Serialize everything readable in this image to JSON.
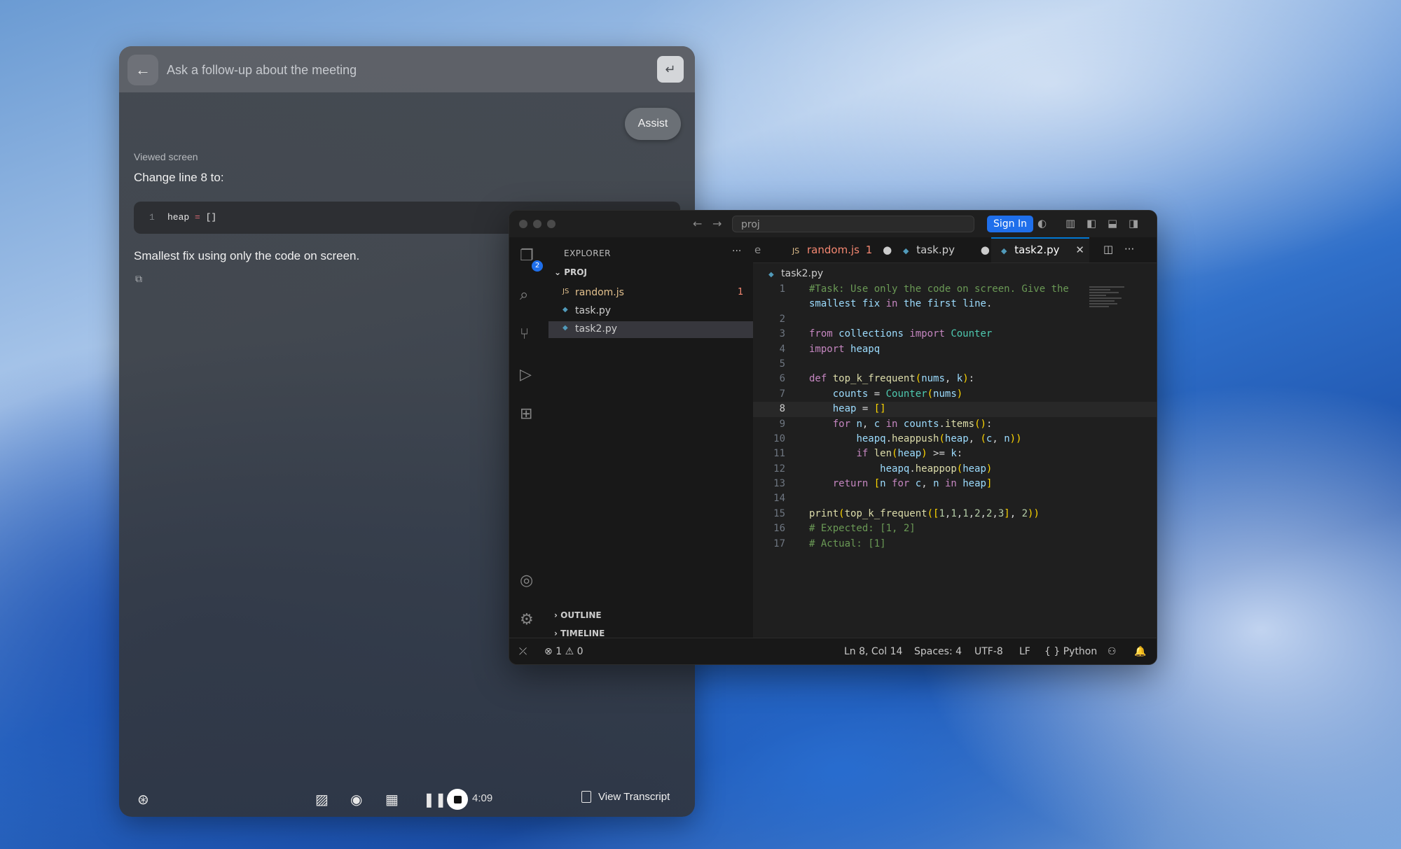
{
  "assistant": {
    "ask_placeholder": "Ask a follow-up about the meeting",
    "assist_label": "Assist",
    "viewed_label": "Viewed screen",
    "change_label": "Change line 8 to:",
    "code_line_number": "1",
    "code_text_var": "heap",
    "code_text_op": " = ",
    "code_text_val": "[]",
    "fix_text": "Smallest fix using only the code on screen.",
    "timer": "4:09",
    "transcript_label": "View Transcript"
  },
  "vscode": {
    "command_center": "proj",
    "sign_in": "Sign In",
    "explorer_title": "EXPLORER",
    "explorer_more": "···",
    "scm_badge": "2",
    "folder": "PROJ",
    "files": [
      {
        "name": "random.js",
        "icon": "JS",
        "badge": "1",
        "color": "#e2c08d"
      },
      {
        "name": "task.py",
        "icon": "py",
        "badge": "",
        "color": "#cccccc"
      },
      {
        "name": "task2.py",
        "icon": "py",
        "badge": "",
        "color": "#cccccc"
      }
    ],
    "sections": [
      "OUTLINE",
      "TIMELINE"
    ],
    "tabs": [
      {
        "name": "random.js",
        "suffix": "1"
      },
      {
        "name": "task.py"
      },
      {
        "name": "task2.py"
      }
    ],
    "tab_partial": "e",
    "breadcrumb": "task2.py",
    "code_lines": [
      {
        "n": "1",
        "t": "#Task: Use only the code on screen. Give the"
      },
      {
        "n": "",
        "t": "smallest fix in the first line."
      },
      {
        "n": "2",
        "t": ""
      },
      {
        "n": "3",
        "t": "from collections import Counter"
      },
      {
        "n": "4",
        "t": "import heapq"
      },
      {
        "n": "5",
        "t": ""
      },
      {
        "n": "6",
        "t": "def top_k_frequent(nums, k):"
      },
      {
        "n": "7",
        "t": "    counts = Counter(nums)"
      },
      {
        "n": "8",
        "t": "    heap = []"
      },
      {
        "n": "9",
        "t": "    for n, c in counts.items():"
      },
      {
        "n": "10",
        "t": "        heapq.heappush(heap, (c, n))"
      },
      {
        "n": "11",
        "t": "        if len(heap) >= k:"
      },
      {
        "n": "12",
        "t": "            heapq.heappop(heap)"
      },
      {
        "n": "13",
        "t": "    return [n for c, n in heap]"
      },
      {
        "n": "14",
        "t": ""
      },
      {
        "n": "15",
        "t": "print(top_k_frequent([1,1,1,2,2,3], 2))"
      },
      {
        "n": "16",
        "t": "# Expected: [1, 2]"
      },
      {
        "n": "17",
        "t": "# Actual: [1]"
      }
    ],
    "status": {
      "errors": "1",
      "warnings": "0",
      "position": "Ln 8, Col 14",
      "spaces": "Spaces: 4",
      "encoding": "UTF-8",
      "eol": "LF",
      "language": "Python"
    }
  }
}
